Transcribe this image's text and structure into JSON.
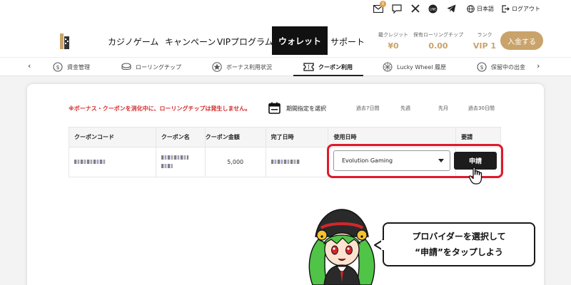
{
  "topbar": {
    "mail_badge": "0",
    "language_label": "日本語",
    "logout_label": "ログアウト"
  },
  "nav": {
    "items": [
      "カジノゲーム",
      "キャンペーン",
      "VIPプログラム",
      "ウォレット",
      "サポート"
    ],
    "active_index": 3
  },
  "stats": {
    "credit_label": "籠クレジット",
    "credit_value": "¥0",
    "chip_label": "保有ローリングチップ",
    "chip_value": "0.00",
    "rank_label": "ランク",
    "rank_value": "VIP 1"
  },
  "deposit_button": "入金する",
  "tabs": [
    {
      "label": "資金管理",
      "icon": "dollar-circle-icon"
    },
    {
      "label": "ローリングチップ",
      "icon": "coin-icon"
    },
    {
      "label": "ボーナス利用状況",
      "icon": "star-icon"
    },
    {
      "label": "クーポン利用",
      "icon": "ticket-icon"
    },
    {
      "label": "Lucky Wheel 履歴",
      "icon": "wheel-icon"
    },
    {
      "label": "保留中の出金",
      "icon": "dollar-circle-icon"
    }
  ],
  "active_tab_index": 3,
  "warning": "※ボーナス・クーポンを消化中に、ローリングチップは発生しません。",
  "period": {
    "label": "期間指定を選択",
    "options": [
      "過去7日間",
      "先週",
      "先月",
      "過去30日間"
    ]
  },
  "table": {
    "headers": [
      "クーポンコード",
      "クーポン名",
      "クーポン金額",
      "完了日時",
      "使用日時",
      "要請"
    ],
    "row": {
      "amount": "5,000",
      "provider": "Evolution Gaming",
      "apply_label": "申請"
    }
  },
  "callout": {
    "line1": "プロバイダーを選択して",
    "line2": "“申請”をタップしよう"
  },
  "colors": {
    "gold": "#c9a36b",
    "warning_red": "#d42b2b",
    "highlight_red": "#e0192c",
    "active_nav_bg": "#111111"
  }
}
